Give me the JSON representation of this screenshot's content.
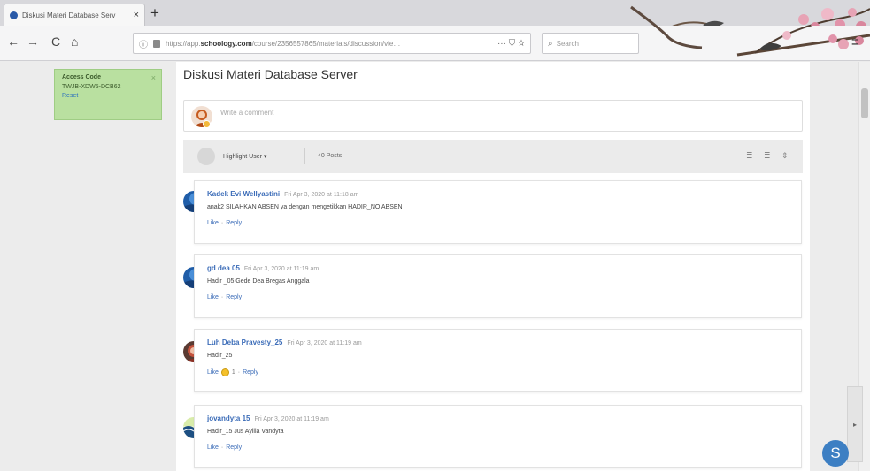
{
  "browser": {
    "tab_title": "Diskusi Materi Database Serv",
    "tab_close": "×",
    "new_tab": "+",
    "back": "←",
    "forward": "→",
    "reload": "C",
    "home": "⌂",
    "url_prefix": "https://app.",
    "url_domain": "schoology.com",
    "url_path": "/course/2356557865/materials/discussion/vie…",
    "url_actions": "··· ⛉ ☆",
    "search_placeholder": "Search",
    "menu": "≡"
  },
  "access_code": {
    "title": "Access Code",
    "code": "TWJB-XDW5-DCB62",
    "link": "Reset",
    "close": "×"
  },
  "page": {
    "title": "Diskusi Materi Database Server",
    "comment_placeholder": "Write a comment"
  },
  "toolbar": {
    "highlight_label": "Highlight User ▾",
    "posts_count": "40 Posts",
    "view_icons": [
      "≣",
      "≣",
      "⇕"
    ]
  },
  "posts": [
    {
      "author": "Kadek Evi Wellyastini",
      "time": "Fri Apr 3, 2020 at 11:18 am",
      "body": "anak2 SILAHKAN ABSEN ya dengan mengetikkan HADIR_NO ABSEN",
      "actions": [
        "Like",
        "Reply"
      ],
      "reaction_count": ""
    },
    {
      "author": "gd dea 05",
      "time": "Fri Apr 3, 2020 at 11:19 am",
      "body": "Hadir _05 Gede Dea Bregas Anggala",
      "actions": [
        "Like",
        "Reply"
      ],
      "reaction_count": ""
    },
    {
      "author": "Luh Deba Pravesty_25",
      "time": "Fri Apr 3, 2020 at 11:19 am",
      "body": "Hadir_25",
      "actions": [
        "Like",
        "Reply"
      ],
      "reaction_count": "1"
    },
    {
      "author": "jovandyta 15",
      "time": "Fri Apr 3, 2020 at 11:19 am",
      "body": "Hadir_15 Jus Ayilla Vandyta",
      "actions": [
        "Like",
        "Reply"
      ],
      "reaction_count": ""
    }
  ],
  "chat_button": "S",
  "side_panel_arrow": "▸",
  "colors": {
    "link": "#3b6cb8",
    "access_bg": "#b9e0a0",
    "chat_button": "#3d7fc3"
  }
}
